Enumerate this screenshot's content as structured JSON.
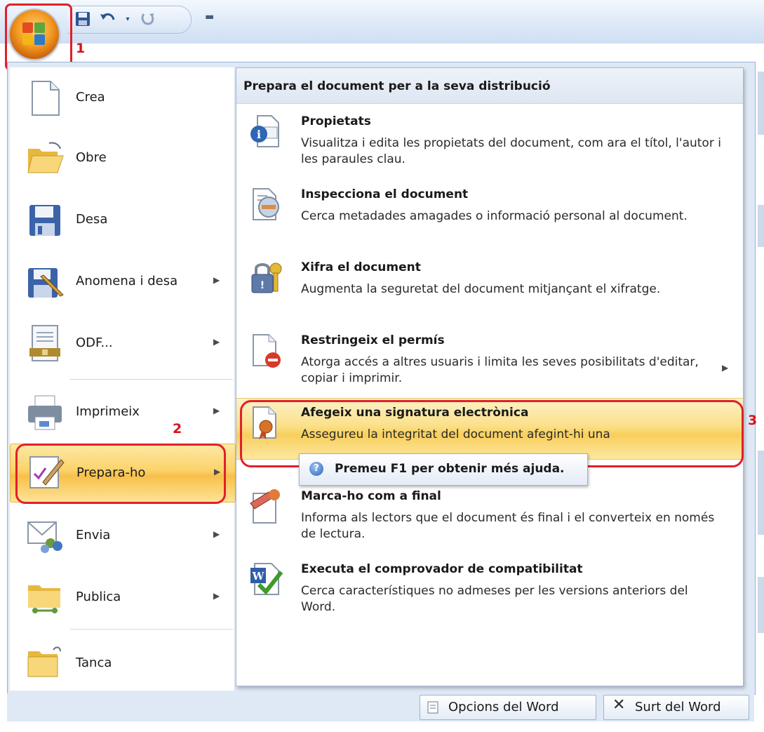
{
  "quick_access": {
    "save_icon": "save-icon",
    "undo_icon": "undo-icon",
    "redo_icon": "redo-icon",
    "customize_icon": "customize-qat-icon"
  },
  "annotations": {
    "one": "1",
    "two": "2",
    "three": "3"
  },
  "left_menu": {
    "items": [
      {
        "label": "Crea",
        "icon": "new-document-icon",
        "submenu": false
      },
      {
        "label": "Obre",
        "icon": "open-folder-icon",
        "submenu": false
      },
      {
        "label": "Desa",
        "icon": "save-disk-icon",
        "submenu": false
      },
      {
        "label": "Anomena i desa",
        "icon": "save-as-icon",
        "submenu": true
      },
      {
        "label": "ODF...",
        "icon": "odf-document-icon",
        "submenu": true
      },
      {
        "label": "Imprimeix",
        "icon": "printer-icon",
        "submenu": true
      },
      {
        "label": "Prepara-ho",
        "icon": "prepare-icon",
        "submenu": true
      },
      {
        "label": "Envia",
        "icon": "send-icon",
        "submenu": true
      },
      {
        "label": "Publica",
        "icon": "publish-icon",
        "submenu": true
      },
      {
        "label": "Tanca",
        "icon": "close-folder-icon",
        "submenu": false
      }
    ]
  },
  "right_panel": {
    "header": "Prepara el document per a la seva distribució",
    "items": [
      {
        "title": "Propietats",
        "desc": "Visualitza i edita les propietats del document, com ara el títol, l'autor i les paraules clau.",
        "icon": "properties-icon"
      },
      {
        "title": "Inspecciona el document",
        "desc": "Cerca metadades amagades o informació personal al document.",
        "icon": "inspect-document-icon"
      },
      {
        "title": "Xifra el document",
        "desc": "Augmenta la seguretat del document mitjançant el xifratge.",
        "icon": "encrypt-lock-icon"
      },
      {
        "title": "Restringeix el permís",
        "desc": "Atorga accés a altres usuaris i limita les seves posibilitats d'editar, copiar i imprimir.",
        "icon": "restrict-permission-icon"
      },
      {
        "title": "Afegeix una signatura electrònica",
        "desc": "Assegureu la integritat del document afegint-hi una",
        "icon": "digital-signature-icon"
      },
      {
        "title": "Marca-ho com a final",
        "desc": "Informa als lectors que el document és final i el converteix en només de lectura.",
        "icon": "mark-final-icon"
      },
      {
        "title": "Executa el comprovador de compatibilitat",
        "desc": "Cerca característiques no admeses per les versions anteriors del Word.",
        "icon": "compatibility-checker-icon"
      }
    ],
    "tooltip": "Premeu F1 per obtenir més ajuda."
  },
  "bottom": {
    "options_label": "Opcions del Word",
    "exit_label": "Surt del Word"
  },
  "colors": {
    "highlight": "#fbd36a",
    "annotation_red": "#e0202a",
    "menu_background": "#dfe9f6"
  }
}
